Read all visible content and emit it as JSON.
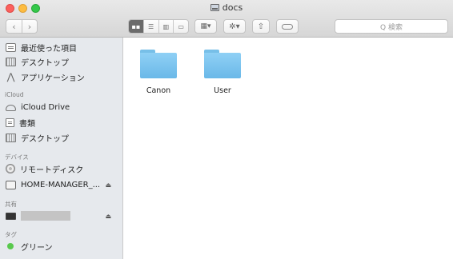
{
  "window": {
    "title": "docs"
  },
  "toolbar": {
    "search_placeholder": "Q 検索",
    "back_symbol": "‹",
    "forward_symbol": "›"
  },
  "sidebar": {
    "favorites": [
      {
        "label": "最近使った項目",
        "icon": "recent-icon"
      },
      {
        "label": "デスクトップ",
        "icon": "desktop-icon"
      },
      {
        "label": "アプリケーション",
        "icon": "applications-icon"
      }
    ],
    "icloud_header": "iCloud",
    "icloud": [
      {
        "label": "iCloud Drive",
        "icon": "icloud-icon"
      },
      {
        "label": "書類",
        "icon": "documents-icon"
      },
      {
        "label": "デスクトップ",
        "icon": "desktop-icon"
      }
    ],
    "devices_header": "デバイス",
    "devices": [
      {
        "label": "リモートディスク",
        "icon": "remote-disc-icon"
      },
      {
        "label": "HOME-MANAGER_...",
        "icon": "hard-drive-icon",
        "eject": "⏏"
      }
    ],
    "shared_header": "共有",
    "shared": [
      {
        "label": "",
        "icon": "monitor-icon",
        "eject": "⏏"
      }
    ],
    "tags_header": "タグ",
    "tags": [
      {
        "label": "グリーン",
        "color": "#59c94d"
      }
    ]
  },
  "content": {
    "items": [
      {
        "name": "Canon",
        "kind": "folder"
      },
      {
        "name": "User",
        "kind": "folder"
      }
    ]
  }
}
